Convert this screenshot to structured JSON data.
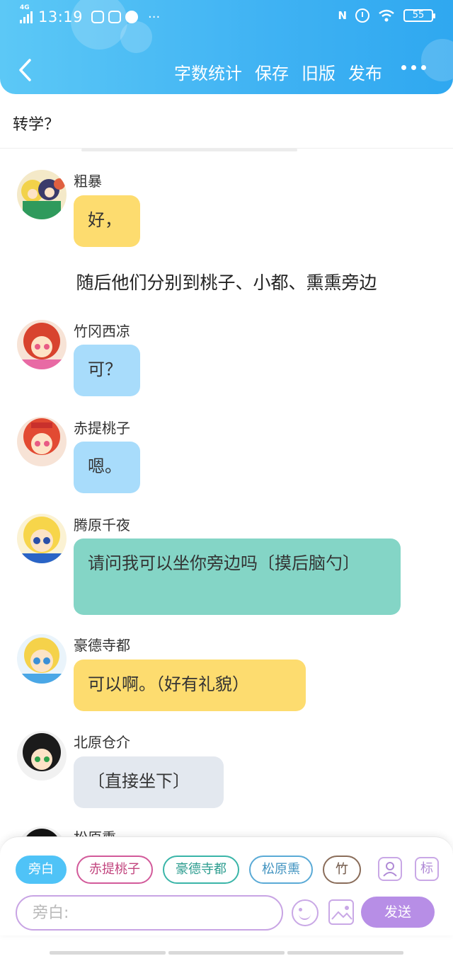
{
  "status_bar": {
    "network": "4G",
    "time": "13:19",
    "dots": "···",
    "nfc": "N",
    "battery": "55"
  },
  "toolbar": {
    "word_count": "字数统计",
    "save": "保存",
    "old_version": "旧版",
    "publish": "发布"
  },
  "story": {
    "title": "转学？"
  },
  "messages": [
    {
      "type": "dialog",
      "name": "粗暴",
      "text": "好，",
      "bubble_color": "#fddc6f"
    },
    {
      "type": "narration",
      "text": "随后他们分别到桃子、小都、熏熏旁边"
    },
    {
      "type": "dialog",
      "name": "竹冈西凉",
      "text": "可？",
      "bubble_color": "#a8dcfb"
    },
    {
      "type": "dialog",
      "name": "赤提桃子",
      "text": "嗯。",
      "bubble_color": "#a8dcfb"
    },
    {
      "type": "dialog",
      "name": "腾原千夜",
      "text": "请问我可以坐你旁边吗〔摸后脑勺〕",
      "bubble_color": "#84d5c6"
    },
    {
      "type": "dialog",
      "name": "豪德寺都",
      "text": "可以啊。（好有礼貌）",
      "bubble_color": "#fddc6f"
    },
    {
      "type": "dialog",
      "name": "北原仓介",
      "text": "〔直接坐下〕",
      "bubble_color": "#e3e8ef"
    },
    {
      "type": "dialog",
      "name": "松原熏",
      "text": ""
    }
  ],
  "composer": {
    "roles": [
      {
        "label": "旁白",
        "active": true
      },
      {
        "label": "赤提桃子",
        "active": false
      },
      {
        "label": "豪德寺都",
        "active": false
      },
      {
        "label": "松原熏",
        "active": false
      },
      {
        "label": "竹",
        "active": false
      }
    ],
    "tag_button": "标",
    "input_placeholder": "旁白:",
    "send_label": "发送"
  },
  "colors": {
    "header_gradient_start": "#5cc8f6",
    "header_gradient_end": "#2fa8f0",
    "send_button": "#b78ee6",
    "active_role": "#4fc3f7"
  }
}
